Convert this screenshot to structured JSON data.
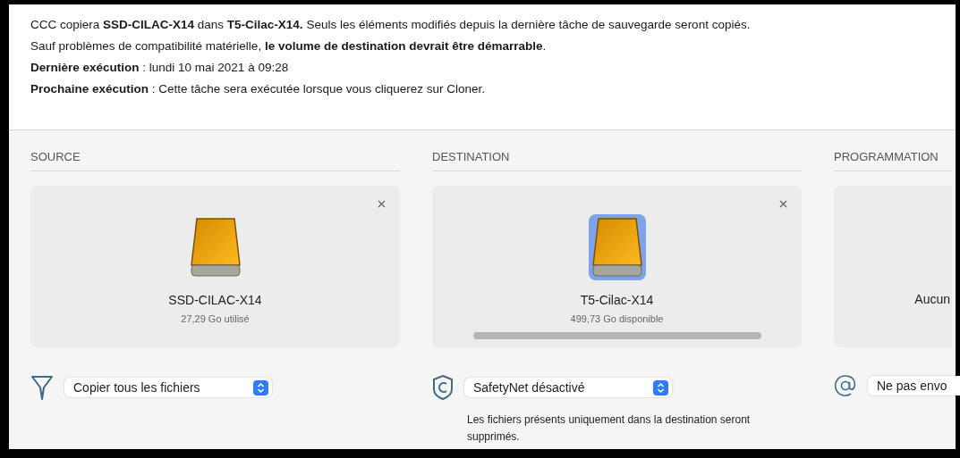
{
  "summary": [
    "CCC copiera **SSD-CILAC-X14** dans **T5-Cilac-X14.** Seuls les éléments modifiés depuis la dernière tâche de sauvegarde seront copiés.",
    "Sauf problèmes de compatibilité matérielle, **le volume de destination devrait être démarrable**.",
    "**Dernière exécution** : lundi 10 mai 2021 à 09:28",
    "**Prochaine exécution** : Cette tâche sera exécutée lorsque vous cliquerez sur Cloner."
  ],
  "columns": [
    {
      "kind": "source",
      "heading": "SOURCE",
      "volume": {
        "name": "SSD-CILAC-X14",
        "info": "27,29 Go utilisé",
        "selected": false
      },
      "option": {
        "value": "Copier tous les fichiers"
      }
    },
    {
      "kind": "destination",
      "heading": "DESTINATION",
      "volume": {
        "name": "T5-Cilac-X14",
        "info": "499,73 Go disponible",
        "selected": true
      },
      "option": {
        "value": "SafetyNet désactivé",
        "note": "Les fichiers présents uniquement dans la destination seront supprimés."
      }
    },
    {
      "kind": "schedule",
      "heading": "PROGRAMMATION",
      "schedule": {
        "text": "Aucun"
      },
      "option": {
        "value": "Ne pas envo"
      }
    }
  ]
}
